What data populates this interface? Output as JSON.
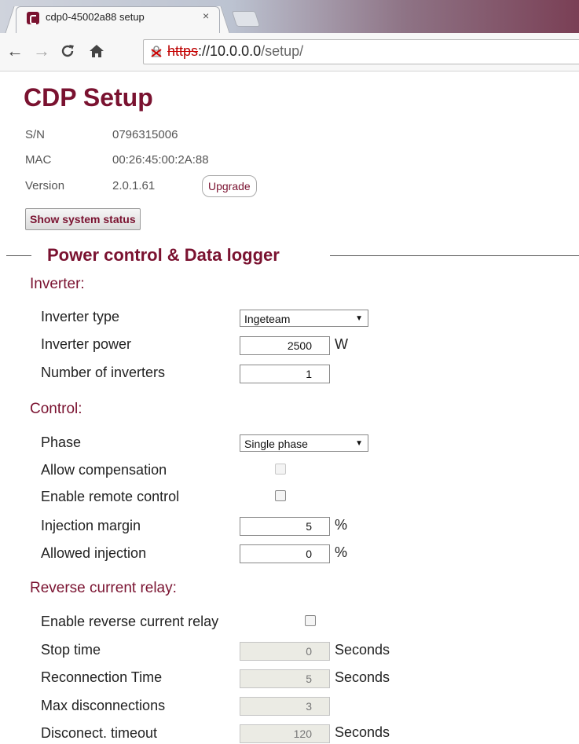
{
  "browser": {
    "tab_title": "cdp0-45002a88 setup",
    "tab_close": "×",
    "url_scheme": "https",
    "url_host": "://10.0.0.0",
    "url_path": "/setup/"
  },
  "page": {
    "title": "CDP Setup",
    "info": [
      {
        "label": "S/N",
        "value": "0796315006"
      },
      {
        "label": "MAC",
        "value": "00:26:45:00:2A:88"
      },
      {
        "label": "Version",
        "value": "2.0.1.61"
      }
    ],
    "upgrade_label": "Upgrade",
    "status_button_label": "Show system status",
    "fieldset_legend": "Power control & Data logger"
  },
  "inverter": {
    "heading": "Inverter:",
    "type_label": "Inverter type",
    "type_value": "Ingeteam",
    "power_label": "Inverter power",
    "power_value": "2500",
    "power_unit": "W",
    "count_label": "Number of inverters",
    "count_value": "1"
  },
  "control": {
    "heading": "Control:",
    "phase_label": "Phase",
    "phase_value": "Single phase",
    "allow_comp_label": "Allow compensation",
    "allow_comp_checked": false,
    "remote_label": "Enable remote control",
    "remote_checked": false,
    "margin_label": "Injection margin",
    "margin_value": "5",
    "margin_unit": "%",
    "allowed_label": "Allowed injection",
    "allowed_value": "0",
    "allowed_unit": "%"
  },
  "relay": {
    "heading": "Reverse current relay:",
    "enable_label": "Enable reverse current relay",
    "enable_checked": false,
    "stop_label": "Stop time",
    "stop_value": "0",
    "stop_unit": "Seconds",
    "reconn_label": "Reconnection Time",
    "reconn_value": "5",
    "reconn_unit": "Seconds",
    "maxdisc_label": "Max disconnections",
    "maxdisc_value": "3",
    "timeout_label": "Disconect. timeout",
    "timeout_value": "120",
    "timeout_unit": "Seconds"
  }
}
